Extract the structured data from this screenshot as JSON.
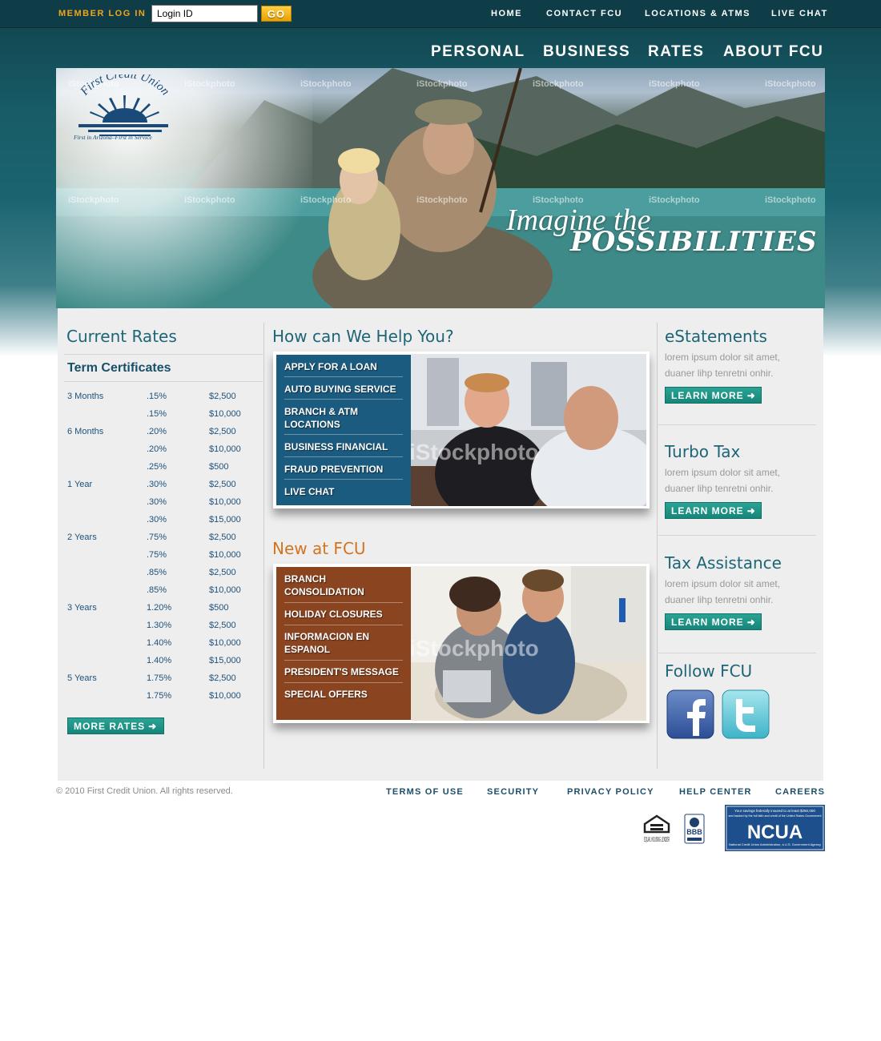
{
  "member_login": {
    "label": "MEMBER LOG IN",
    "input_value": "Login ID",
    "go_label": "GO"
  },
  "top_nav": [
    "HOME",
    "CONTACT FCU",
    "LOCATIONS & ATMS",
    "LIVE CHAT"
  ],
  "main_nav": [
    "PERSONAL",
    "BUSINESS",
    "RATES",
    "ABOUT FCU"
  ],
  "hero": {
    "logo_name": "First Credit Union",
    "logo_tagline": "First in Arizona–First in Service",
    "headline_line1": "Imagine the",
    "headline_line2": "POSSIBILITIES",
    "watermark": "iStockphoto"
  },
  "rates": {
    "title": "Current Rates",
    "subtitle": "Term Certificates",
    "rows": [
      [
        "3 Months",
        ".15%",
        "$2,500"
      ],
      [
        "",
        ".15%",
        "$10,000"
      ],
      [
        "6 Months",
        ".20%",
        "$2,500"
      ],
      [
        "",
        ".20%",
        "$10,000"
      ],
      [
        "",
        ".25%",
        "$500"
      ],
      [
        "1 Year",
        ".30%",
        "$2,500"
      ],
      [
        "",
        ".30%",
        "$10,000"
      ],
      [
        "",
        ".30%",
        "$15,000"
      ],
      [
        "2 Years",
        ".75%",
        "$2,500"
      ],
      [
        "",
        ".75%",
        "$10,000"
      ],
      [
        "",
        ".85%",
        "$2,500"
      ],
      [
        "",
        ".85%",
        "$10,000"
      ],
      [
        "3 Years",
        "1.20%",
        "$500"
      ],
      [
        "",
        "1.30%",
        "$2,500"
      ],
      [
        "",
        "1.40%",
        "$10,000"
      ],
      [
        "",
        "1.40%",
        "$15,000"
      ],
      [
        "5 Years",
        "1.75%",
        "$2,500"
      ],
      [
        "",
        "1.75%",
        "$10,000"
      ]
    ],
    "more_label": "MORE RATES"
  },
  "help": {
    "title": "How can We Help You?",
    "items": [
      "APPLY FOR A LOAN",
      "AUTO BUYING SERVICE",
      "BRANCH & ATM LOCATIONS",
      "BUSINESS FINANCIAL",
      "FRAUD PREVENTION",
      "LIVE CHAT"
    ],
    "watermark": "iStockphoto"
  },
  "news": {
    "title": "New at FCU",
    "items": [
      "BRANCH CONSOLIDATION",
      "HOLIDAY CLOSURES",
      "INFORMACION EN ESPANOL",
      "PRESIDENT'S MESSAGE",
      "SPECIAL OFFERS"
    ],
    "watermark": "iStockphoto"
  },
  "sidebar": {
    "blocks": [
      {
        "title": "eStatements",
        "text": "lorem ipsum dolor sit amet, duaner lihp tenretni onhir.",
        "button": "LEARN MORE"
      },
      {
        "title": "Turbo Tax",
        "text": "lorem ipsum dolor sit amet, duaner lihp tenretni onhir.",
        "button": "LEARN MORE"
      },
      {
        "title": "Tax Assistance",
        "text": "lorem ipsum dolor sit amet, duaner lihp tenretni onhir.",
        "button": "LEARN MORE"
      }
    ],
    "follow_title": "Follow FCU",
    "social": [
      "facebook-icon",
      "twitter-icon"
    ]
  },
  "footer": {
    "copyright": "© 2010 First Credit Union. All rights reserved.",
    "links": [
      "TERMS OF USE",
      "SECURITY",
      "PRIVACY POLICY",
      "HELP CENTER",
      "CAREERS"
    ],
    "badges": {
      "equal_housing": "EQUAL HOUSING LENDER",
      "bbb": "BBB",
      "ncua": "NCUA",
      "ncua_line1": "Your savings federally insured to at least $250,000",
      "ncua_line2": "and backed by the full faith and credit of the United States Government",
      "ncua_line3": "National Credit Union Administration, a U.S. Government Agency"
    }
  },
  "colors": {
    "header_teal": "#0f3d47",
    "login_orange": "#f2a41a",
    "title_teal": "#1d6577",
    "title_orange": "#d2741f",
    "button_green": "#1d9488",
    "help_panel_blue": "#1a5d80",
    "news_panel_brown": "#8a4420",
    "footer_link_navy": "#1d4e6a"
  }
}
